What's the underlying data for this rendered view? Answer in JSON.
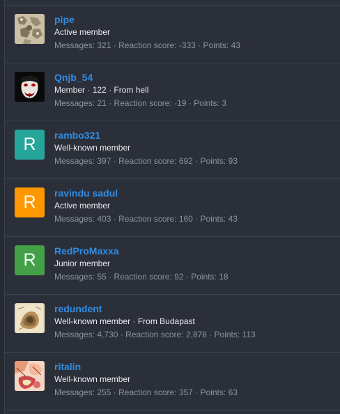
{
  "labels": {
    "messages": "Messages:",
    "reaction_score": "Reaction score:",
    "points": "Points:",
    "separator": "·"
  },
  "colors": {
    "background": "#2b2f39",
    "username": "#2f8ee6",
    "divider": "#3c414c"
  },
  "members": [
    {
      "username": "pipe",
      "title": "Active member",
      "location": "",
      "messages": "321",
      "reaction_score": "-333",
      "points": "43",
      "avatar": {
        "type": "image",
        "icon": "beige-pattern-avatar"
      }
    },
    {
      "username": "Qnjb_54",
      "title": "Member",
      "age": "122",
      "location": "From hell",
      "messages": "21",
      "reaction_score": "-19",
      "points": "3",
      "avatar": {
        "type": "image",
        "icon": "demon-face-avatar"
      }
    },
    {
      "username": "rambo321",
      "title": "Well-known member",
      "location": "",
      "messages": "397",
      "reaction_score": "692",
      "points": "93",
      "avatar": {
        "type": "letter",
        "letter": "R",
        "color": "#26a69a"
      }
    },
    {
      "username": "ravindu sadul",
      "title": "Active member",
      "location": "",
      "messages": "403",
      "reaction_score": "160",
      "points": "43",
      "avatar": {
        "type": "letter",
        "letter": "R",
        "color": "#ff9800"
      }
    },
    {
      "username": "RedProMaxxa",
      "title": "Junior member",
      "location": "",
      "messages": "55",
      "reaction_score": "92",
      "points": "18",
      "avatar": {
        "type": "letter",
        "letter": "R",
        "color": "#43a047"
      }
    },
    {
      "username": "redundent",
      "title": "Well-known member",
      "location": "From Budapast",
      "messages": "4,730",
      "reaction_score": "2,878",
      "points": "113",
      "avatar": {
        "type": "image",
        "icon": "sketch-drawing-avatar"
      }
    },
    {
      "username": "ritalin",
      "title": "Well-known member",
      "location": "",
      "messages": "255",
      "reaction_score": "357",
      "points": "63",
      "avatar": {
        "type": "image",
        "icon": "illustration-avatar"
      }
    }
  ]
}
